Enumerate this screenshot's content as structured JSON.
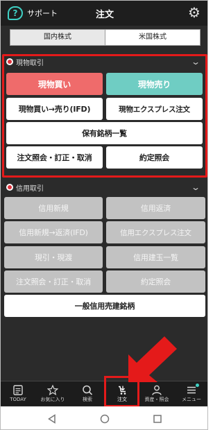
{
  "header": {
    "support_label": "サポート",
    "support_icon": "?",
    "title": "注文",
    "settings_icon": "⚙"
  },
  "market_tabs": [
    {
      "label": "国内株式",
      "active": true
    },
    {
      "label": "米国株式",
      "active": false
    }
  ],
  "cash": {
    "title": "現物取引",
    "buttons": {
      "buy": "現物買い",
      "sell": "現物売り",
      "ifd": "現物買い→売り(IFD)",
      "express": "現物エクスプレス注文",
      "holdings": "保有銘柄一覧",
      "inquiry": "注文照会・訂正・取消",
      "executions": "約定照会"
    }
  },
  "margin": {
    "title": "信用取引",
    "buttons": {
      "new": "信用新規",
      "repay": "信用返済",
      "ifd": "信用新規→返済(IFD)",
      "express": "信用エクスプレス注文",
      "delivery": "現引・現渡",
      "positions": "信用建玉一覧",
      "inquiry": "注文照会・訂正・取消",
      "executions": "約定照会",
      "general_short": "一般信用売建銘柄"
    }
  },
  "bottom_nav": [
    {
      "label": "TODAY",
      "icon": "today-icon"
    },
    {
      "label": "お気に入り",
      "icon": "star-icon"
    },
    {
      "label": "検索",
      "icon": "search-icon"
    },
    {
      "label": "注文",
      "icon": "order-icon",
      "active": true
    },
    {
      "label": "資産・照会",
      "icon": "person-icon"
    },
    {
      "label": "メニュー",
      "icon": "menu-icon"
    }
  ],
  "colors": {
    "buy": "#ef6b6b",
    "sell": "#6fcdc3",
    "highlight": "#e41a1a",
    "accent": "#3fd0c4"
  }
}
